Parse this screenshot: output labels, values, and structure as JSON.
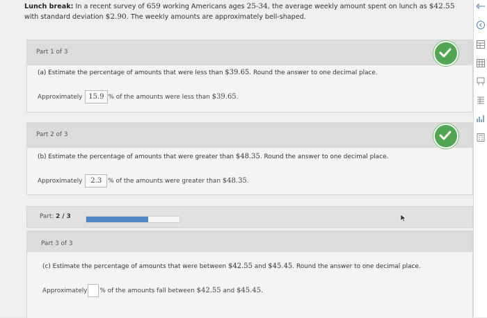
{
  "intro": {
    "label": "Lunch break:",
    "text_a": "In a recent survey of ",
    "n": "659",
    "text_b": " working Americans ages ",
    "ages": "25-34",
    "text_c": ", the average weekly amount spent on lunch as ",
    "mean": "$42.55",
    "text_d": "with standard deviation ",
    "sd": "$2.90",
    "text_e": ". The weekly amounts are approximately bell-shaped."
  },
  "part1": {
    "header": "Part 1 of 3",
    "question_a": "(a) Estimate the percentage of amounts that were less than ",
    "question_val": "$39.65",
    "question_b": ". Round the answer to one decimal place.",
    "answer_prefix": "Approximately",
    "answer_value": "15.9",
    "answer_suffix_a": "% of the amounts were less than ",
    "answer_suffix_val": "$39.65",
    "answer_suffix_b": "."
  },
  "part2": {
    "header": "Part 2 of 3",
    "question_a": "(b) Estimate the percentage of amounts that were greater than ",
    "question_val": "$48.35",
    "question_b": ". Round the answer to one decimal place.",
    "answer_prefix": "Approximately",
    "answer_value": "2.3",
    "answer_suffix_a": "% of the amounts were greater than ",
    "answer_suffix_val": "$48.35",
    "answer_suffix_b": "."
  },
  "progress": {
    "label": "Part:",
    "value_text": "2 / 3",
    "fraction": 0.667
  },
  "part3": {
    "header": "Part 3 of 3",
    "question_a": "(c) Estimate the percentage of amounts that were between ",
    "question_val1": "$42.55",
    "question_mid": " and ",
    "question_val2": "$45.45",
    "question_b": ". Round the answer to one decimal place.",
    "answer_prefix": "Approximately",
    "answer_value": "",
    "answer_suffix_a": "% of the amounts fall between ",
    "answer_suffix_val1": "$42.55",
    "answer_suffix_mid": " and ",
    "answer_suffix_val2": "$45.45",
    "answer_suffix_b": "."
  },
  "colors": {
    "check": "#51a553",
    "progress": "#4f86c6"
  },
  "sidebar_icons": [
    "toggle-icon",
    "expand-icon",
    "table-icon",
    "grid-icon",
    "tools-icon",
    "table-icon",
    "chart-icon",
    "calculator-icon"
  ]
}
